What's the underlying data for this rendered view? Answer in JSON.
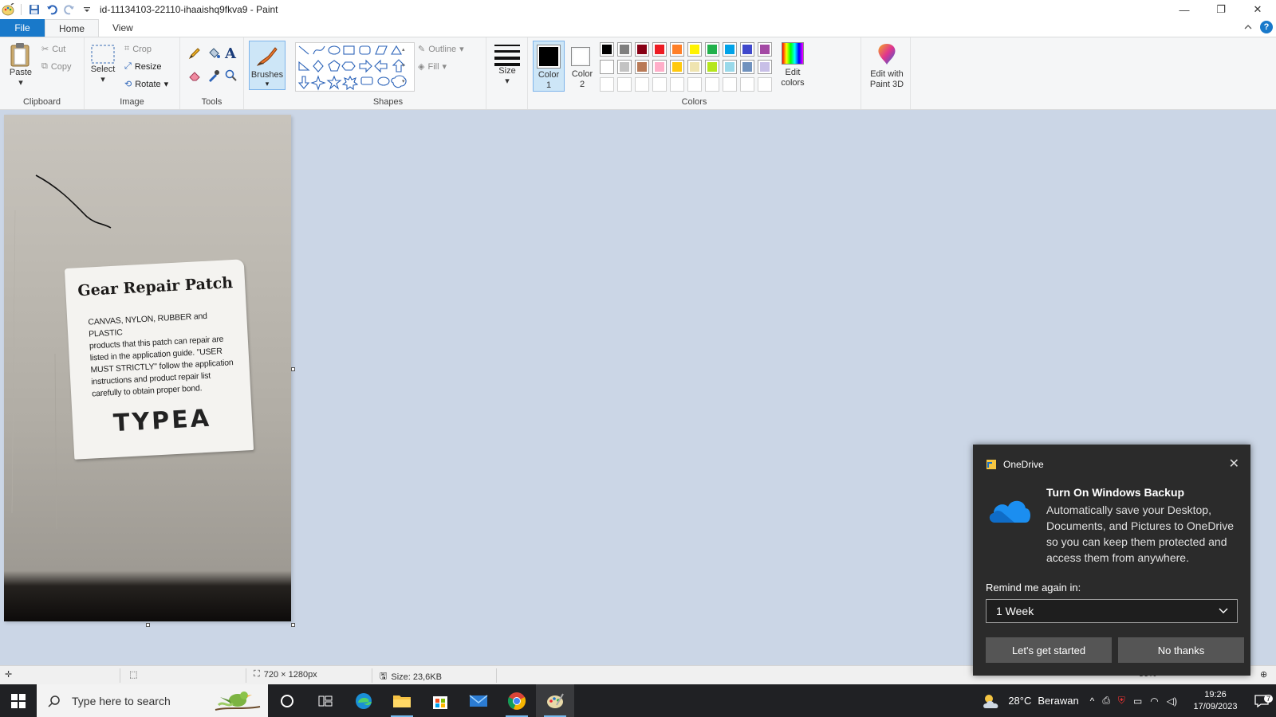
{
  "window": {
    "title": "id-11134103-22110-ihaaishq9fkva9 - Paint",
    "controls": {
      "minimize": "—",
      "restore": "❐",
      "close": "✕"
    }
  },
  "tabs": {
    "file": "File",
    "home": "Home",
    "view": "View",
    "help": "?"
  },
  "ribbon": {
    "clipboard": {
      "paste": "Paste",
      "cut": "Cut",
      "copy": "Copy",
      "label": "Clipboard"
    },
    "image": {
      "select": "Select",
      "crop": "Crop",
      "resize": "Resize",
      "rotate": "Rotate",
      "label": "Image"
    },
    "tools": {
      "label": "Tools",
      "text_glyph": "A"
    },
    "brushes": {
      "label": "Brushes"
    },
    "shapes": {
      "outline": "Outline",
      "fill": "Fill",
      "label": "Shapes"
    },
    "size": {
      "label": "Size"
    },
    "color1": {
      "line1": "Color",
      "line2": "1",
      "value": "#000000"
    },
    "color2": {
      "line1": "Color",
      "line2": "2",
      "value": "#ffffff"
    },
    "colors": {
      "label": "Colors",
      "row1": [
        "#000000",
        "#7f7f7f",
        "#880015",
        "#ed1c24",
        "#ff7f27",
        "#fff200",
        "#22b14c",
        "#00a2e8",
        "#3f48cc",
        "#a349a4"
      ],
      "row2": [
        "#ffffff",
        "#c3c3c3",
        "#b97a57",
        "#ffaec9",
        "#ffc90e",
        "#efe4b0",
        "#b5e61d",
        "#99d9ea",
        "#7092be",
        "#c8bfe7"
      ]
    },
    "edit_colors": {
      "line1": "Edit",
      "line2": "colors"
    },
    "paint3d": {
      "line1": "Edit with",
      "line2": "Paint 3D"
    }
  },
  "canvas": {
    "label_title": "Gear Repair Patch",
    "label_lines": [
      "CANVAS, NYLON, RUBBER and PLASTIC",
      "products that this patch can repair are",
      "listed in the application guide. \"USER",
      "MUST STRICTLY\" follow the application",
      "instructions and product repair list",
      "carefully to obtain proper bond."
    ],
    "label_type": "TYPEA"
  },
  "statusbar": {
    "dimensions": "720 × 1280px",
    "size": "Size: 23,6KB",
    "zoom": "50%"
  },
  "taskbar": {
    "search_placeholder": "Type here to search",
    "weather_temp": "28°C",
    "weather_desc": "Berawan",
    "time": "19:26",
    "date": "17/09/2023",
    "notif_count": "7"
  },
  "toast": {
    "app": "OneDrive",
    "title": "Turn On Windows Backup",
    "body": "Automatically save your Desktop, Documents, and Pictures to OneDrive so you can keep them protected and access them from anywhere.",
    "remind_label": "Remind me again in:",
    "remind_value": "1 Week",
    "primary_button": "Let's get started",
    "secondary_button": "No thanks"
  }
}
